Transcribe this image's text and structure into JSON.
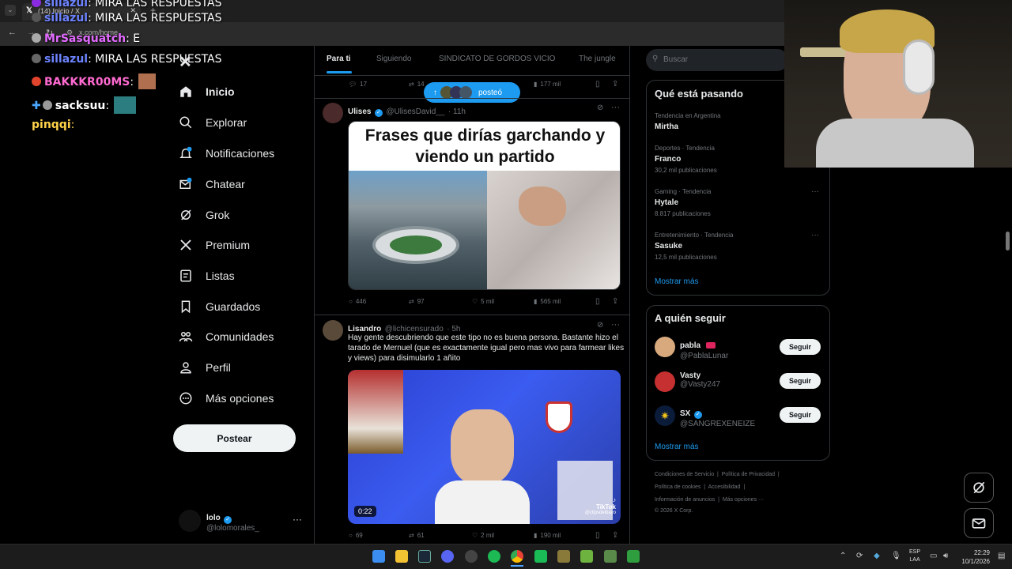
{
  "browser": {
    "tab_title": "(14) Inicio / X",
    "url": "x.com/home"
  },
  "chat": [
    {
      "user": "sillazul",
      "msg": "MIRA LAS RESPUESTAS",
      "color": "#6d83ff"
    },
    {
      "user": "MrSasquatch",
      "msg": "E",
      "color": "#e26bff"
    },
    {
      "user": "sillazul",
      "msg": "MIRA LAS RESPUESTAS",
      "color": "#6d83ff"
    },
    {
      "user": "BAKKKR00MS",
      "msg": "",
      "color": "#ff6ad1"
    },
    {
      "user": "sacksuu",
      "msg": "",
      "color": "#ffffff"
    },
    {
      "user": "pinqqi",
      "msg": "",
      "color": "#ffd24a"
    }
  ],
  "sidebar": {
    "items": [
      {
        "label": "Inicio",
        "icon": "home-icon"
      },
      {
        "label": "Explorar",
        "icon": "search-icon"
      },
      {
        "label": "Notificaciones",
        "icon": "bell-icon"
      },
      {
        "label": "Chatear",
        "icon": "mail-icon"
      },
      {
        "label": "Grok",
        "icon": "grok-icon"
      },
      {
        "label": "Premium",
        "icon": "x-logo-icon"
      },
      {
        "label": "Listas",
        "icon": "list-icon"
      },
      {
        "label": "Guardados",
        "icon": "bookmark-icon"
      },
      {
        "label": "Comunidades",
        "icon": "people-icon"
      },
      {
        "label": "Perfil",
        "icon": "person-icon"
      },
      {
        "label": "Más opciones",
        "icon": "more-icon"
      }
    ],
    "post_button": "Postear",
    "account": {
      "name": "lolo",
      "handle": "@lolomorales_"
    }
  },
  "feed": {
    "tabs": [
      "Para ti",
      "Siguiendo",
      "SINDICATO DE GORDOS VICIO",
      "The jungle"
    ],
    "new_posts_pill": "posteó",
    "prev_actions": {
      "replies": "17",
      "retweets": "14",
      "views": "177 mil"
    },
    "posts": [
      {
        "name": "Ulises",
        "handle": "@UlisesDavid__",
        "time": "11h",
        "image_title": "Frases que dirías garchando y viendo un partido",
        "actions": {
          "replies": "446",
          "retweets": "97",
          "likes": "5 mil",
          "views": "565 mil"
        }
      },
      {
        "name": "Lisandro",
        "handle": "@lichicensurado",
        "time": "5h",
        "text": "Hay gente descubriendo que este tipo no es buena persona. Bastante hizo el tarado de Mernuel (que es exactamente igual pero mas vivo para farmear likes y views) para disimularlo 1 añito",
        "video_duration": "0:22",
        "video_badge": "TikTok",
        "video_credit": "@clipsdelbayo",
        "actions": {
          "replies": "69",
          "retweets": "61",
          "likes": "2 mil",
          "views": "190 mil"
        }
      }
    ]
  },
  "right": {
    "search_placeholder": "Buscar",
    "trends_title": "Qué está pasando",
    "trends": [
      {
        "meta": "Tendencia en Argentina",
        "name": "Mirtha",
        "count": ""
      },
      {
        "meta": "Deportes · Tendencia",
        "name": "Franco",
        "count": "30,2 mil publicaciones"
      },
      {
        "meta": "Gaming · Tendencia",
        "name": "Hytale",
        "count": "8.817 publicaciones"
      },
      {
        "meta": "Entretenimiento · Tendencia",
        "name": "Sasuke",
        "count": "12,5 mil publicaciones"
      }
    ],
    "show_more": "Mostrar más",
    "follow_title": "A quién seguir",
    "follow": [
      {
        "name": "pabla",
        "handle": "@PablaLunar",
        "button": "Seguir"
      },
      {
        "name": "Vasty",
        "handle": "@Vasty247",
        "button": "Seguir"
      },
      {
        "name": "SX",
        "handle": "@SANGREXENEIZE",
        "button": "Seguir"
      }
    ],
    "footer": [
      "Condiciones de Servicio",
      "Política de Privacidad",
      "Política de cookies",
      "Accesibilidad",
      "Información de anuncios",
      "Más opciones ···",
      "© 2026 X Corp."
    ]
  },
  "taskbar": {
    "lang": "ESP",
    "lang2": "LAA",
    "time": "22:29",
    "date": "10/1/2026"
  },
  "colors": {
    "accent": "#1d9bf0",
    "bg": "#000000",
    "border": "#2f3336"
  }
}
